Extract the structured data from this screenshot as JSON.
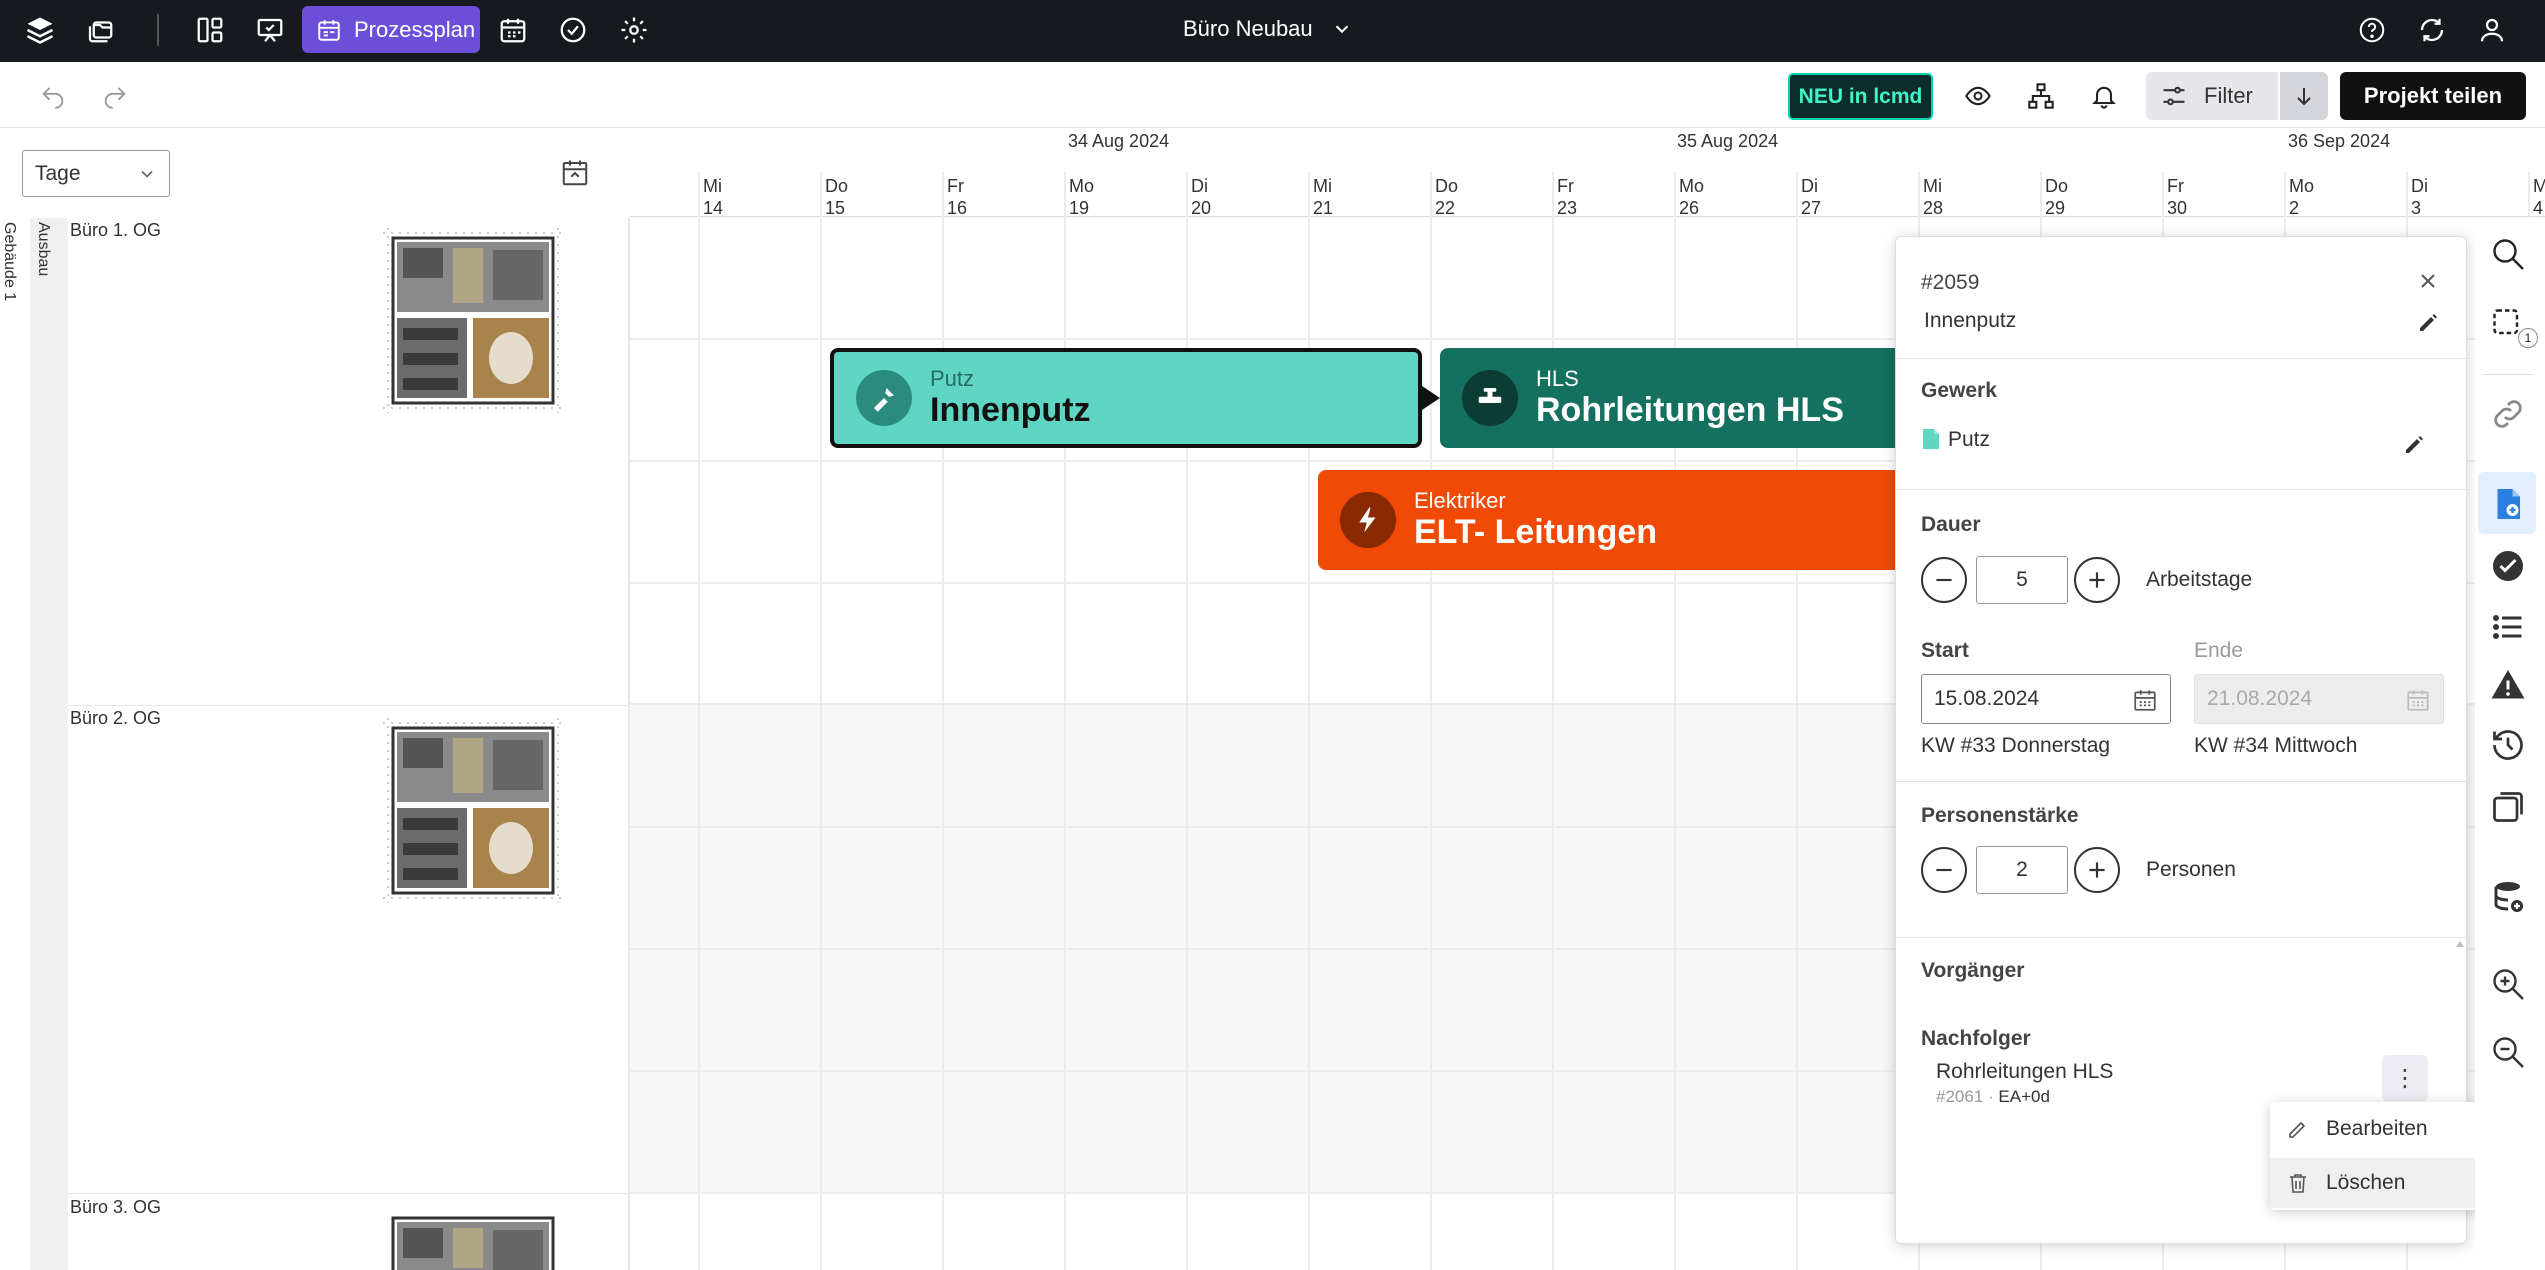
{
  "app": {
    "project_name": "Büro Neubau",
    "active_view_label": "Prozessplan",
    "neu_badge": "NEU in lcmd",
    "filter_label": "Filter",
    "share_label": "Projekt teilen"
  },
  "timeline": {
    "unit_select": "Tage",
    "months": [
      "34 Aug 2024",
      "35 Aug 2024",
      "36 Sep 2024"
    ],
    "days": [
      {
        "wd": "Mi",
        "d": "14"
      },
      {
        "wd": "Do",
        "d": "15"
      },
      {
        "wd": "Fr",
        "d": "16"
      },
      {
        "wd": "Mo",
        "d": "19"
      },
      {
        "wd": "Di",
        "d": "20"
      },
      {
        "wd": "Mi",
        "d": "21"
      },
      {
        "wd": "Do",
        "d": "22"
      },
      {
        "wd": "Fr",
        "d": "23"
      },
      {
        "wd": "Mo",
        "d": "26"
      },
      {
        "wd": "Di",
        "d": "27"
      },
      {
        "wd": "Mi",
        "d": "28"
      },
      {
        "wd": "Do",
        "d": "29"
      },
      {
        "wd": "Fr",
        "d": "30"
      },
      {
        "wd": "Mo",
        "d": "2"
      },
      {
        "wd": "Di",
        "d": "3"
      },
      {
        "wd": "M",
        "d": "4"
      }
    ]
  },
  "left": {
    "building": "Gebäude 1",
    "section": "Ausbau",
    "rows": [
      "Büro 1. OG",
      "Büro 2. OG",
      "Büro 3. OG"
    ]
  },
  "tasks": [
    {
      "trade": "Putz",
      "name": "Innenputz",
      "color": "#5ed6c3"
    },
    {
      "trade": "HLS",
      "name": "Rohrleitungen  HLS",
      "color": "#14705f"
    },
    {
      "trade": "Elektriker",
      "name": "ELT- Leitungen",
      "color": "#f04a06"
    }
  ],
  "panel": {
    "id": "#2059",
    "title": "Innenputz",
    "gewerk_label": "Gewerk",
    "gewerk_value": "Putz",
    "dauer_label": "Dauer",
    "dauer_value": "5",
    "dauer_unit": "Arbeitstage",
    "start_label": "Start",
    "start_value": "15.08.2024",
    "start_kw": "KW #33 Donnerstag",
    "ende_label": "Ende",
    "ende_value": "21.08.2024",
    "ende_kw": "KW #34 Mittwoch",
    "personen_label": "Personenstärke",
    "personen_value": "2",
    "personen_unit": "Personen",
    "vorgaenger_label": "Vorgänger",
    "nachfolger_label": "Nachfolger",
    "nachfolger_name": "Rohrleitungen HLS",
    "nachfolger_id": "#2061",
    "nachfolger_rel": "EA+0d"
  },
  "context_menu": {
    "edit": "Bearbeiten",
    "delete": "Löschen"
  },
  "right_toolbar_badge": "1"
}
